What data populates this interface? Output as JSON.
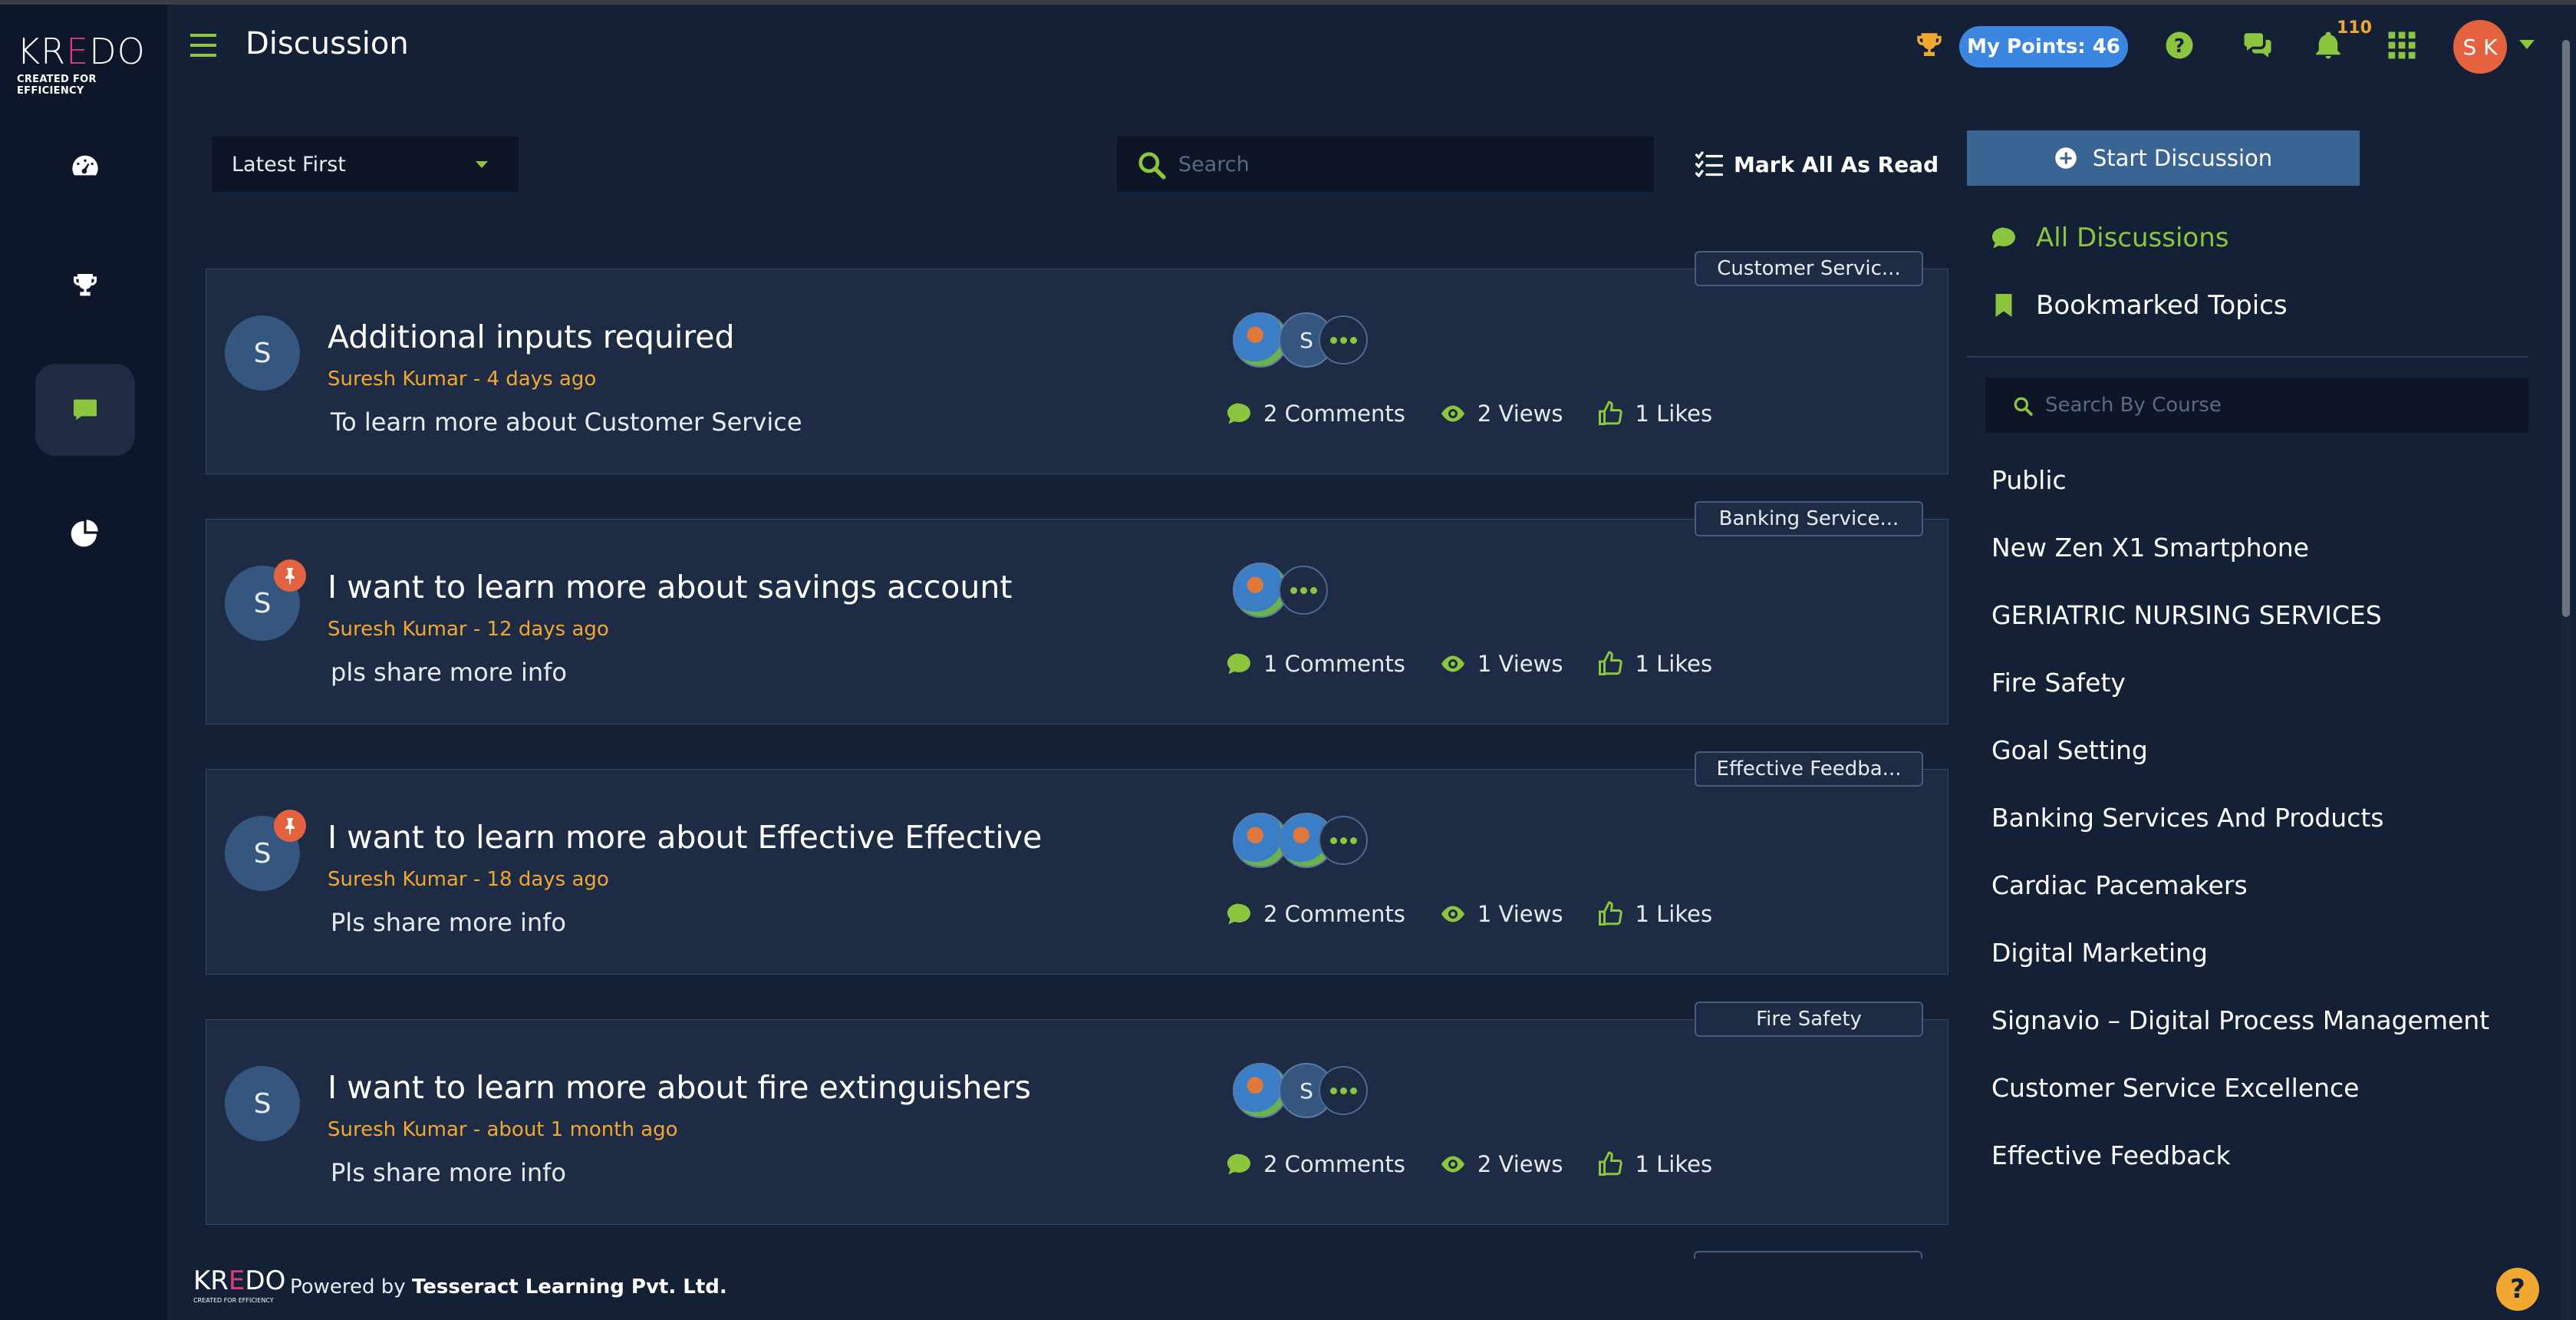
{
  "brand": {
    "logo_text": "KREDO",
    "tagline": "CREATED FOR EFFICIENCY"
  },
  "header": {
    "title": "Discussion",
    "points_label": "My Points: 46",
    "notification_count": "110",
    "user_initials": "S K"
  },
  "toolbar": {
    "sort_selected": "Latest First",
    "search_placeholder": "Search",
    "mark_all_read": "Mark All As Read",
    "start_discussion": "Start Discussion"
  },
  "discussions": [
    {
      "tag": "Customer Servic...",
      "avatar": "S",
      "title": "Additional inputs required",
      "meta": "Suresh Kumar - 4 days ago",
      "desc": "To learn more about Customer Service",
      "comments": "2 Comments",
      "views": "2 Views",
      "likes": "1 Likes",
      "pinned": false,
      "participant_letter": "S"
    },
    {
      "tag": "Banking Service...",
      "avatar": "S",
      "title": "I want to learn more about savings account",
      "meta": "Suresh Kumar - 12 days ago",
      "desc": "pls share more info",
      "comments": "1 Comments",
      "views": "1 Views",
      "likes": "1 Likes",
      "pinned": true
    },
    {
      "tag": "Effective Feedba...",
      "avatar": "S",
      "title": "I want to learn more about Effective Effective",
      "meta": "Suresh Kumar - 18 days ago",
      "desc": "Pls share more info",
      "comments": "2 Comments",
      "views": "1 Views",
      "likes": "1 Likes",
      "pinned": true
    },
    {
      "tag": "Fire Safety",
      "avatar": "S",
      "title": "I want to learn more about fire extinguishers",
      "meta": "Suresh Kumar - about 1 month ago",
      "desc": "Pls share more info",
      "comments": "2 Comments",
      "views": "2 Views",
      "likes": "1 Likes",
      "pinned": false,
      "participant_letter": "S"
    }
  ],
  "right_panel": {
    "all_discussions": "All Discussions",
    "bookmarked": "Bookmarked Topics",
    "course_search_placeholder": "Search By Course",
    "courses": [
      "Public",
      "New Zen X1 Smartphone",
      "GERIATRIC NURSING SERVICES",
      "Fire Safety",
      "Goal Setting",
      "Banking Services And Products",
      "Cardiac Pacemakers",
      "Digital Marketing",
      "Signavio – Digital Process Management",
      "Customer Service Excellence",
      "Effective Feedback"
    ]
  },
  "footer": {
    "powered_by": "Powered by",
    "company": "Tesseract Learning Pvt. Ltd.",
    "help_symbol": "?"
  },
  "colors": {
    "accent_green": "#8cc63f",
    "accent_orange": "#f0a830",
    "points_blue": "#3a86e0",
    "background": "#142036",
    "card": "#1d2b45"
  }
}
